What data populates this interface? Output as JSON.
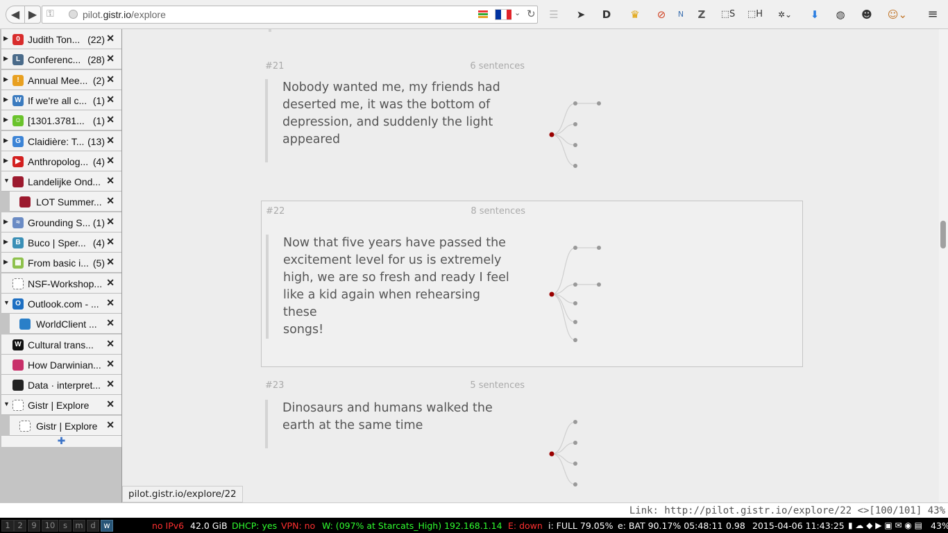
{
  "browser": {
    "url_host": "pilot.",
    "url_domain": "gistr.io",
    "url_path": "/explore"
  },
  "tabs": [
    {
      "title": "Judith Ton...",
      "count": "(22)",
      "color": "#d82c2c",
      "glyph": "0"
    },
    {
      "title": "Conferenc...",
      "count": "(28)",
      "color": "#4a6b8a",
      "glyph": "L"
    },
    {
      "title": "Annual Mee...",
      "count": "(2)",
      "color": "#e8a020",
      "glyph": "!"
    },
    {
      "title": "If we're all c...",
      "count": "(1)",
      "color": "#3b7bbf",
      "glyph": "W"
    },
    {
      "title": "[1301.3781...",
      "count": "(1)",
      "color": "#6ac32c",
      "glyph": "☺"
    },
    {
      "title": "Claidière: T...",
      "count": "(13)",
      "color": "#3c84d6",
      "glyph": "G"
    },
    {
      "title": "Anthropolog...",
      "count": "(4)",
      "color": "#d32020",
      "glyph": "▶"
    },
    {
      "title": "Landelijke Ond...",
      "count": "",
      "color": "#9c1a2e",
      "glyph": ""
    },
    {
      "title": "LOT Summer...",
      "count": "",
      "color": "#9c1a2e",
      "glyph": ""
    },
    {
      "title": "Grounding S...",
      "count": "(1)",
      "color": "#6a8bc4",
      "glyph": "≈"
    },
    {
      "title": "Buco | Sper...",
      "count": "(4)",
      "color": "#3a8fb6",
      "glyph": "B"
    },
    {
      "title": "From basic i...",
      "count": "(5)",
      "color": "#8ec14c",
      "glyph": "▦"
    },
    {
      "title": "NSF-Workshop...",
      "count": "",
      "color": "#ffffff",
      "glyph": ""
    },
    {
      "title": "Outlook.com - ...",
      "count": "",
      "color": "#1d6fc2",
      "glyph": "O"
    },
    {
      "title": "WorldClient ...",
      "count": "",
      "color": "#2a7fc8",
      "glyph": ""
    },
    {
      "title": "Cultural trans...",
      "count": "",
      "color": "#111111",
      "glyph": "W"
    },
    {
      "title": "How Darwinian...",
      "count": "",
      "color": "#c8306a",
      "glyph": ""
    },
    {
      "title": "Data · interpret...",
      "count": "",
      "color": "#222222",
      "glyph": ""
    },
    {
      "title": "Gistr | Explore",
      "count": "",
      "color": "#ffffff",
      "glyph": ""
    },
    {
      "title": "Gistr | Explore",
      "count": "",
      "color": "#ffffff",
      "glyph": ""
    }
  ],
  "entries": [
    {
      "id": "#21",
      "sentences": "6 sentences",
      "lines": [
        "Nobody wanted me, my friends had",
        "deserted me, it was the bottom of",
        "depression, and suddenly the light",
        "appeared"
      ]
    },
    {
      "id": "#22",
      "sentences": "8 sentences",
      "lines": [
        "Now that five years have passed the",
        "excitement level for us is extremely",
        "high, we are so fresh and ready I feel",
        "like a kid again when rehearsing these",
        "songs!"
      ]
    },
    {
      "id": "#23",
      "sentences": "5 sentences",
      "lines": [
        "Dinosaurs and humans walked the",
        "earth at the same time"
      ]
    }
  ],
  "status_link": "pilot.gistr.io/explore/22",
  "command_line": "Link: http://pilot.gistr.io/explore/22 <>[100/101] 43%",
  "workspaces": [
    "1",
    "2",
    "9",
    "10",
    "s",
    "m",
    "d",
    "w"
  ],
  "status_bar": [
    {
      "text": "no IPv6",
      "color": "#ff3030"
    },
    {
      "text": "42.0 GiB",
      "color": "#ffffff"
    },
    {
      "text": "DHCP: yes",
      "color": "#30ff30"
    },
    {
      "text": "VPN: no",
      "color": "#ff3030"
    },
    {
      "text": "W: (097% at Starcats_High) 192.168.1.14",
      "color": "#30ff30"
    },
    {
      "text": "E: down",
      "color": "#ff3030"
    },
    {
      "text": "i: FULL 79.05%",
      "color": "#ffffff"
    },
    {
      "text": "e: BAT 90.17% 05:48:11",
      "color": "#ffffff"
    },
    {
      "text": "0.98",
      "color": "#ffffff"
    },
    {
      "text": "2015-04-06 11:43:25",
      "color": "#ffffff"
    },
    {
      "text": "43%",
      "color": "#ffffff"
    }
  ]
}
